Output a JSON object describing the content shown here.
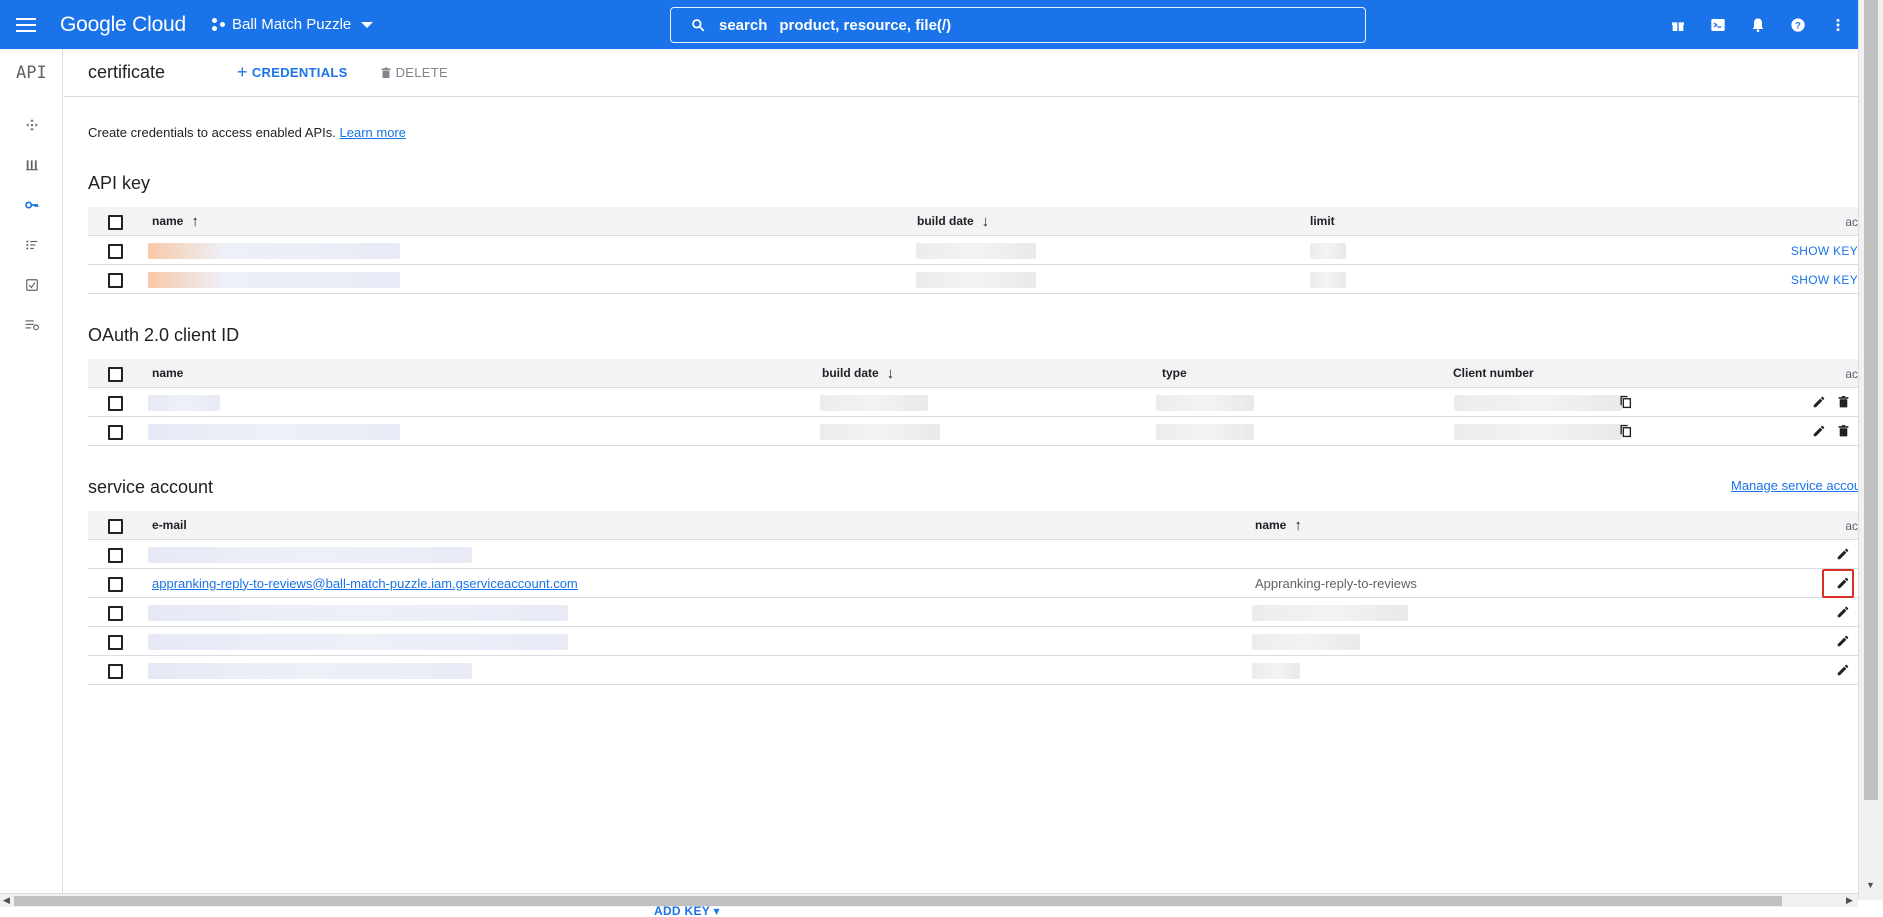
{
  "topbar": {
    "logo": "Google Cloud",
    "project": "Ball Match Puzzle",
    "search_label": "search",
    "search_placeholder": "product, resource, file(/)",
    "icons": [
      "gift-icon",
      "terminal-icon",
      "bell-icon",
      "help-icon",
      "more-vert-icon"
    ]
  },
  "leftnav": {
    "api_label": "API",
    "items": [
      "dashboard-icon",
      "library-icon",
      "key-icon",
      "consent-icon",
      "checkbox-icon",
      "settings-list-icon"
    ]
  },
  "header": {
    "title": "certificate",
    "credentials_label": "CREDENTIALS",
    "delete_label": "DELETE"
  },
  "intro": {
    "text": "Create credentials to access enabled APIs.",
    "learn_more": "Learn more"
  },
  "api_key": {
    "title": "API key",
    "columns": {
      "name": "name",
      "build_date": "build date",
      "limit": "limit",
      "actions": "ac"
    },
    "rows": [
      {
        "action": "SHOW KEY"
      },
      {
        "action": "SHOW KEY"
      }
    ]
  },
  "oauth": {
    "title": "OAuth 2.0 client ID",
    "columns": {
      "name": "name",
      "build_date": "build date",
      "type": "type",
      "client_number": "Client number",
      "actions": "ac"
    }
  },
  "service_account": {
    "title": "service account",
    "manage_link": "Manage service accou",
    "columns": {
      "email": "e-mail",
      "name": "name",
      "actions": "ac"
    },
    "visible_row": {
      "email": "appranking-reply-to-reviews@ball-match-puzzle.iam.gserviceaccount.com",
      "name": "Appranking-reply-to-reviews"
    }
  },
  "footer": {
    "add_key": "ADD KEY"
  },
  "colors": {
    "brand_blue": "#1a73e8",
    "highlight_red": "#d93025"
  }
}
